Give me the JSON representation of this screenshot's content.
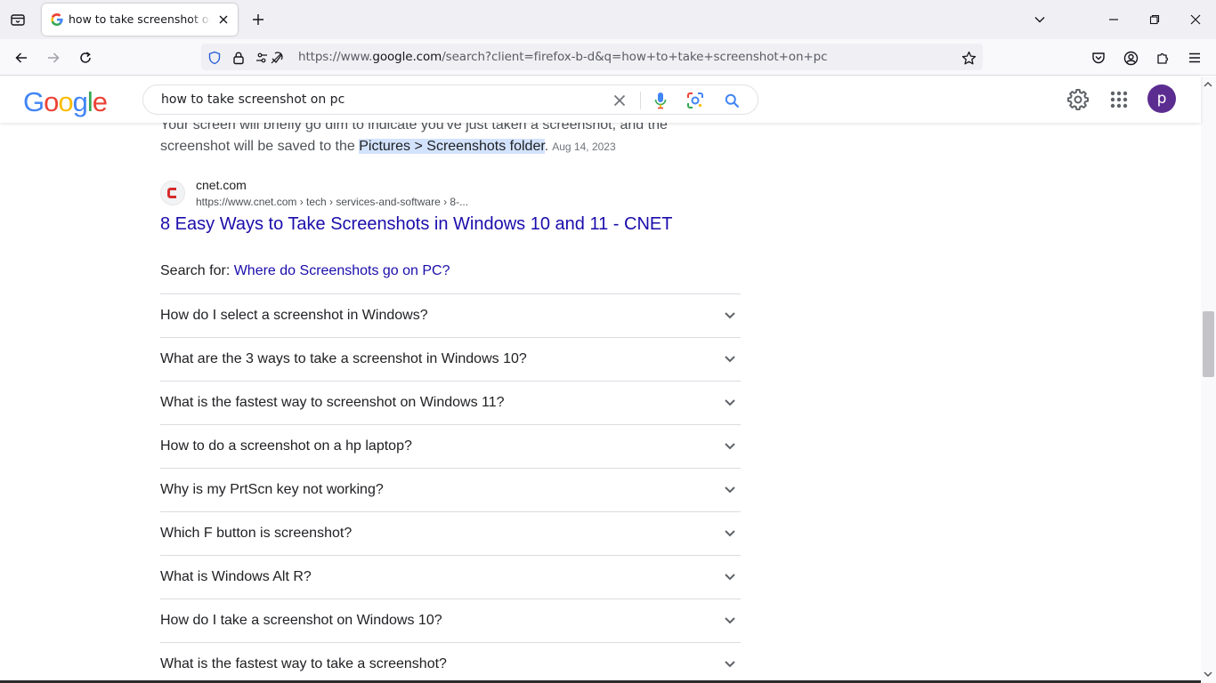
{
  "browser": {
    "tab_title": "how to take screenshot on pc - Google Search",
    "url_prefix": "https://www.",
    "url_domain": "google.com",
    "url_rest": "/search?client=firefox-b-d&q=how+to+take+screenshot+on+pc"
  },
  "google": {
    "logo_letters": [
      "G",
      "o",
      "o",
      "g",
      "l",
      "e"
    ],
    "logo_colors": [
      "#4285f4",
      "#ea4335",
      "#fbbc05",
      "#4285f4",
      "#34a853",
      "#ea4335"
    ],
    "search_query": "how to take screenshot on pc",
    "avatar_letter": "p"
  },
  "results": {
    "snippet_line1": "Your screen will briefly go dim to indicate you've just taken a screenshot, and the",
    "snippet_line2_pre": "screenshot will be saved to the ",
    "snippet_highlight": "Pictures > Screenshots folder",
    "snippet_line2_post": ".",
    "snippet_date": "Aug 14, 2023",
    "site_name": "cnet.com",
    "site_url": "https://www.cnet.com › tech › services-and-software › 8-...",
    "title": "8 Easy Ways to Take Screenshots in Windows 10 and 11 - CNET",
    "search_for_label": "Search for: ",
    "search_for_link": "Where do Screenshots go on PC?"
  },
  "paa": [
    "How do I select a screenshot in Windows?",
    "What are the 3 ways to take a screenshot in Windows 10?",
    "What is the fastest way to screenshot on Windows 11?",
    "How to do a screenshot on a hp laptop?",
    "Why is my PrtScn key not working?",
    "Which F button is screenshot?",
    "What is Windows Alt R?",
    "How do I take a screenshot on Windows 10?",
    "What is the fastest way to take a screenshot?"
  ],
  "colors": {
    "link": "#1a0dab",
    "highlight": "#d3e3fd",
    "avatar": "#5c2d91",
    "cnet_red": "#d62c2c"
  }
}
